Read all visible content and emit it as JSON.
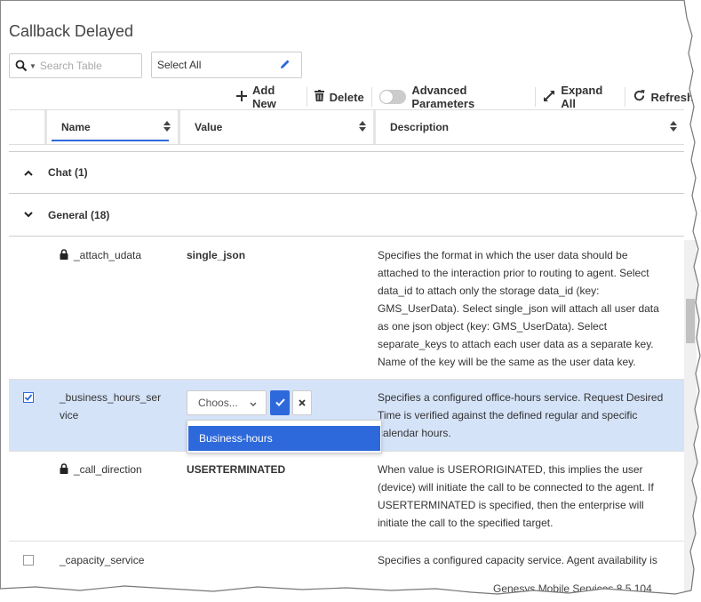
{
  "page": {
    "title": "Callback Delayed"
  },
  "search": {
    "placeholder": "Search Table"
  },
  "select_all": {
    "label": "Select All"
  },
  "toolbar": {
    "add_new": "Add New",
    "delete": "Delete",
    "advanced": "Advanced Parameters",
    "expand_all": "Expand All",
    "refresh": "Refresh"
  },
  "columns": {
    "name": "Name",
    "value": "Value",
    "description": "Description"
  },
  "groups": [
    {
      "label": "Chat (1)",
      "expanded": false
    },
    {
      "label": "General (18)",
      "expanded": true
    }
  ],
  "rows": [
    {
      "name": "_attach_udata",
      "value": "single_json",
      "description": "Specifies the format in which the user data should be attached to the interaction prior to routing to agent. Select data_id to attach only the storage data_id (key: GMS_UserData). Select single_json will attach all user data as one json object (key: GMS_UserData). Select separate_keys to attach each user data as a separate key. Name of the key will be the same as the user data key."
    },
    {
      "name": "_business_hours_ser vice",
      "value": "Choos...",
      "description": "Specifies a configured office-hours service. Request Desired Time is verified against the defined regular and specific calendar hours."
    },
    {
      "name": "_call_direction",
      "value": "USERTERMINATED",
      "description": "When value is USERORIGINATED, this implies the user (device) will initiate the call to be connected to the agent. If USERTERMINATED is specified, then the enterprise will initiate the call to the specified target."
    },
    {
      "name": "_capacity_service",
      "value": "",
      "description": "Specifies a configured capacity service. Agent availability is"
    }
  ],
  "dropdown": {
    "option": "Business-hours"
  },
  "footer": {
    "text": "Genesys Mobile Services 8.5.104"
  },
  "colors": {
    "accent": "#2e69db",
    "selected_row": "#d5e3f8"
  }
}
